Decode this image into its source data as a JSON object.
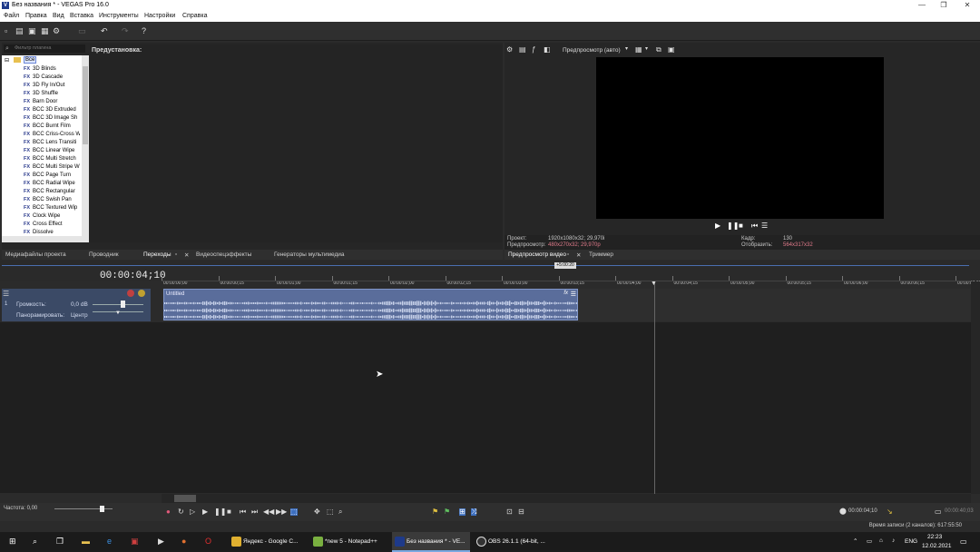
{
  "window": {
    "title": "Без названия * - VEGAS Pro 16.0",
    "logo": "V",
    "minimize": "—",
    "restore": "❐",
    "close": "✕"
  },
  "menu": [
    "Файл",
    "Правка",
    "Вид",
    "Вставка",
    "Инструменты",
    "Настройки",
    "Справка"
  ],
  "plugins": {
    "search_placeholder": "Фильтр плагина",
    "root": "Все",
    "items": [
      "3D Blinds",
      "3D Cascade",
      "3D Fly In/Out",
      "3D Shuffle",
      "Barn Door",
      "BCC 3D Extruded",
      "BCC 3D Image Sh",
      "BCC Burnt Film",
      "BCC Criss-Cross W",
      "BCC Lens Transiti",
      "BCC Linear Wipe",
      "BCC Multi Stretch",
      "BCC Multi Stripe W",
      "BCC Page Turn",
      "BCC Radial Wipe",
      "BCC Rectangular",
      "BCC Swish Pan",
      "BCC Textured Wip",
      "Clock Wipe",
      "Cross Effect",
      "Dissolve"
    ],
    "fx_tag": "FX"
  },
  "presets_label": "Предустановка:",
  "left_tabs": [
    "Медиафайлы проекта",
    "Проводник",
    "Переходы",
    "Видеоспецэффекты",
    "Генераторы мультимедиа"
  ],
  "preview": {
    "mode_label": "Предпросмотр (авто)",
    "project_label": "Проект:",
    "project_value": "1920x1080x32; 29,970i",
    "preview_label": "Предпросмотр:",
    "preview_value": "480x270x32; 29,970p",
    "frame_label": "Кадр:",
    "frame_value": "130",
    "display_label": "Отобразить:",
    "display_value": "564x317x32"
  },
  "preview_tabs": [
    "Предпросмотр видео",
    "Триммер"
  ],
  "timeline": {
    "timecode": "00:00:04;10",
    "cursor_flag": "+5:00:20",
    "ruler": [
      "00:00:00;00",
      "00:00:00;15",
      "00:00:01;00",
      "00:00:01;15",
      "00:00:02;00",
      "00:00:02;15",
      "00:00:03;00",
      "00:00:03;15",
      "00:00:04;00",
      "00:00:04;15",
      "00:00:05;00",
      "00:00:05;15",
      "00:00:06;00",
      "00:00:06;15",
      "00:00:07;00"
    ],
    "track": {
      "number": "1",
      "volume_label": "Громкость:",
      "volume_value": "0,0 dB",
      "pan_label": "Панорамировать:",
      "pan_value": "Центр",
      "clip_name": "Untitled",
      "fx_badge": "fx"
    }
  },
  "bottom": {
    "rate_label": "Частота: 0,00",
    "time_display": "00:00:04;10",
    "end_time": "00:00:40;03",
    "record_time": "Время записи (2 каналов): 617:55:50"
  },
  "taskbar": {
    "apps": [
      "Яндекс - Google C...",
      "*new 5 - Notepad++",
      "Без названия * - VE...",
      "OBS 26.1.1 (64-bit, ..."
    ],
    "lang": "ENG",
    "time": "22:23",
    "date": "12.02.2021"
  },
  "colors": {
    "accent": "#5a6d9b",
    "track_header": "#3b4a66",
    "info_pink": "#e07a8a"
  }
}
